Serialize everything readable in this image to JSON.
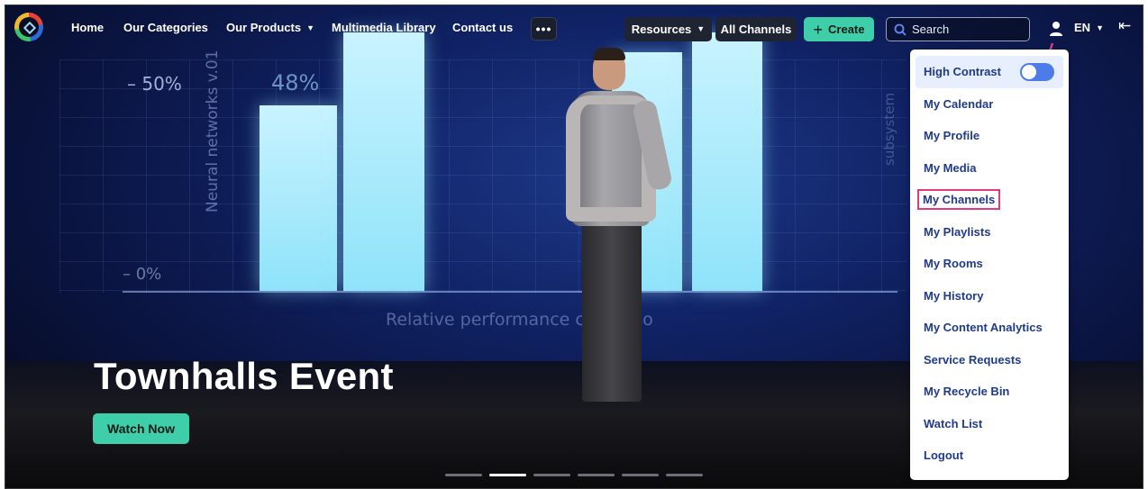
{
  "nav": {
    "home": "Home",
    "categories": "Our Categories",
    "products": "Our Products",
    "library": "Multimedia Library",
    "contact": "Contact us",
    "more": "•••",
    "resources": "Resources",
    "all_channels": "All Channels",
    "create": "Create",
    "search_placeholder": "Search",
    "language": "EN"
  },
  "hero": {
    "title": "Townhalls Event",
    "cta": "Watch Now",
    "slides": 6,
    "active_slide": 2,
    "backdrop_text": {
      "label_50": "– 50%",
      "label_48": "48%",
      "label_0": "– 0%",
      "rotated_left": "Neural networks v.01",
      "rotated_right": "subsystem",
      "bottom": "Relative performance co  pariso"
    }
  },
  "user_menu": {
    "high_contrast": "High Contrast",
    "high_contrast_on": true,
    "items": [
      "My Calendar",
      "My Profile",
      "My Media",
      "My Channels",
      "My Playlists",
      "My Rooms",
      "My History",
      "My Content Analytics",
      "Service Requests",
      "My Recycle Bin",
      "Watch List",
      "Logout"
    ],
    "highlighted": "My Channels"
  },
  "colors": {
    "accent": "#3ecfaa",
    "menu_text": "#1f3a8a",
    "annotation": "#e03c7d",
    "toggle": "#4d7ce8"
  },
  "icons": [
    "logo-icon",
    "chevron-down-icon",
    "plus-icon",
    "search-icon",
    "user-icon",
    "collapse-icon"
  ]
}
